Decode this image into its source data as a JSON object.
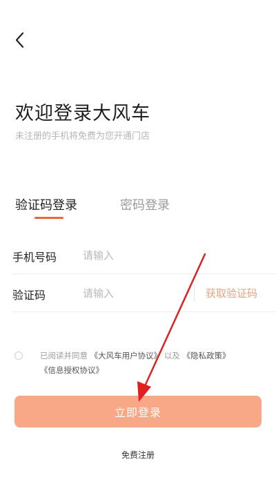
{
  "header": {
    "back_icon": "chevron-left-icon",
    "title": "欢迎登录大风车",
    "subtitle": "未注册的手机将免费为您开通门店"
  },
  "tabs": [
    {
      "label": "验证码登录",
      "active": true
    },
    {
      "label": "密码登录",
      "active": false
    }
  ],
  "form": {
    "phone_label": "手机号码",
    "phone_placeholder": "请输入",
    "code_label": "验证码",
    "code_placeholder": "请输入",
    "get_code_label": "获取验证码"
  },
  "agreement": {
    "prefix": "已阅读并同意",
    "user_agreement": "《大风车用户协议》",
    "and": "以及",
    "privacy_policy": "《隐私政策》",
    "info_auth": "《信息授权协议》"
  },
  "login_button": "立即登录",
  "register_link": "免费注册",
  "colors": {
    "accent": "#e8663a",
    "button": "#f8a787",
    "get_code": "#efa07d",
    "annotation_arrow": "#e02020"
  }
}
